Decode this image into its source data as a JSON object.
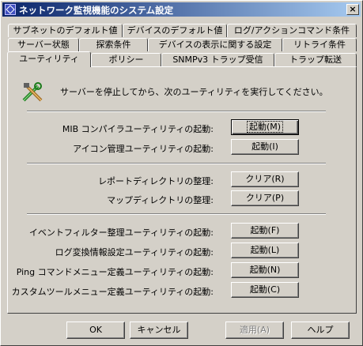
{
  "window": {
    "title": "ネットワーク監視機能のシステム設定",
    "close_label": "×"
  },
  "tabs": {
    "row1": [
      "サブネットのデフォルト値",
      "デバイスのデフォルト値",
      "ログ/アクションコマンド条件"
    ],
    "row2": [
      "サーバー状態",
      "探索条件",
      "デバイスの表示に関する設定",
      "リトライ条件"
    ],
    "row3": [
      "ユーティリティ",
      "ポリシー",
      "SNMPv3 トラップ受信",
      "トラップ転送"
    ],
    "active": "ユーティリティ"
  },
  "panel": {
    "message": "サーバーを停止してから、次のユーティリティを実行してください。",
    "rows": [
      {
        "label": "MIB コンパイラユーティリティの起動:",
        "button": "起動(M)"
      },
      {
        "label": "アイコン管理ユーティリティの起動:",
        "button": "起動(I)"
      },
      {
        "label": "レポートディレクトリの整理:",
        "button": "クリア(R)"
      },
      {
        "label": "マップディレクトリの整理:",
        "button": "クリア(P)"
      },
      {
        "label": "イベントフィルター整理ユーティリティの起動:",
        "button": "起動(F)"
      },
      {
        "label": "ログ変換情報設定ユーティリティの起動:",
        "button": "起動(L)"
      },
      {
        "label": "Ping コマンドメニュー定義ユーティリティの起動:",
        "button": "起動(N)"
      },
      {
        "label": "カスタムツールメニュー定義ユーティリティの起動:",
        "button": "起動(C)"
      }
    ]
  },
  "footer": {
    "ok": "OK",
    "cancel": "キャンセル",
    "apply": "適用(A)",
    "help": "ヘルプ"
  }
}
